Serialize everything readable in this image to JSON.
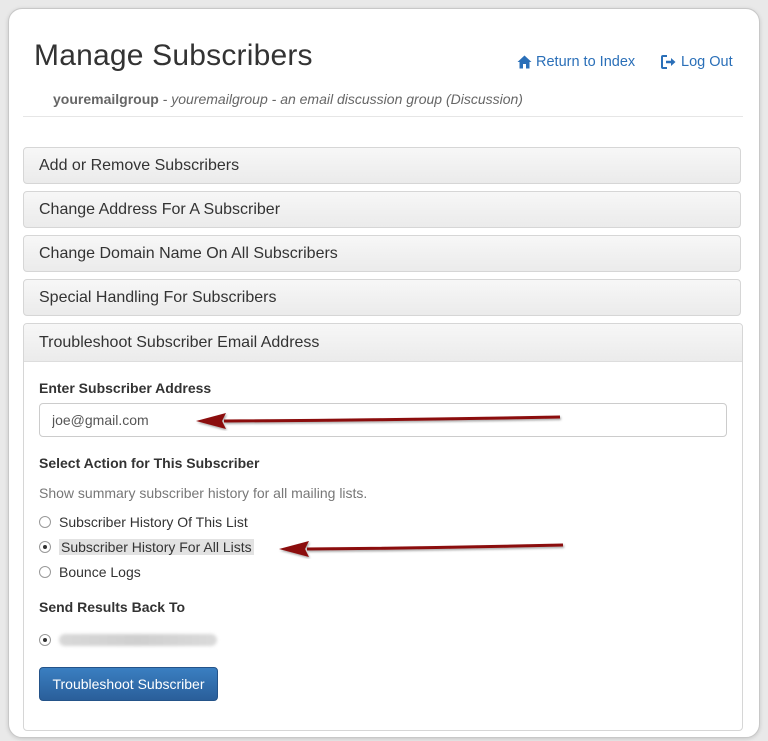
{
  "header": {
    "title": "Manage Subscribers",
    "group_name": "youremailgroup",
    "separator": " - ",
    "group_description": "youremailgroup - an email discussion group (Discussion)",
    "return_link": "Return to Index",
    "logout_link": "Log Out"
  },
  "panels": [
    {
      "label": "Add or Remove Subscribers"
    },
    {
      "label": "Change Address For A Subscriber"
    },
    {
      "label": "Change Domain Name On All Subscribers"
    },
    {
      "label": "Special Handling For Subscribers"
    },
    {
      "label": "Troubleshoot Subscriber Email Address"
    }
  ],
  "troubleshoot": {
    "address_label": "Enter Subscriber Address",
    "address_value": "joe@gmail.com",
    "action_label": "Select Action for This Subscriber",
    "action_help": "Show summary subscriber history for all mailing lists.",
    "options": [
      {
        "label": "Subscriber History Of This List",
        "checked": false
      },
      {
        "label": "Subscriber History For All Lists",
        "checked": true
      },
      {
        "label": "Bounce Logs",
        "checked": false
      }
    ],
    "send_label": "Send Results Back To",
    "submit_label": "Troubleshoot Subscriber"
  },
  "colors": {
    "link": "#2a6fb8",
    "button": "#2f6dab",
    "annotation_arrow": "#8b0d0d"
  },
  "icons": {
    "return": "home-icon",
    "logout": "logout-icon"
  }
}
